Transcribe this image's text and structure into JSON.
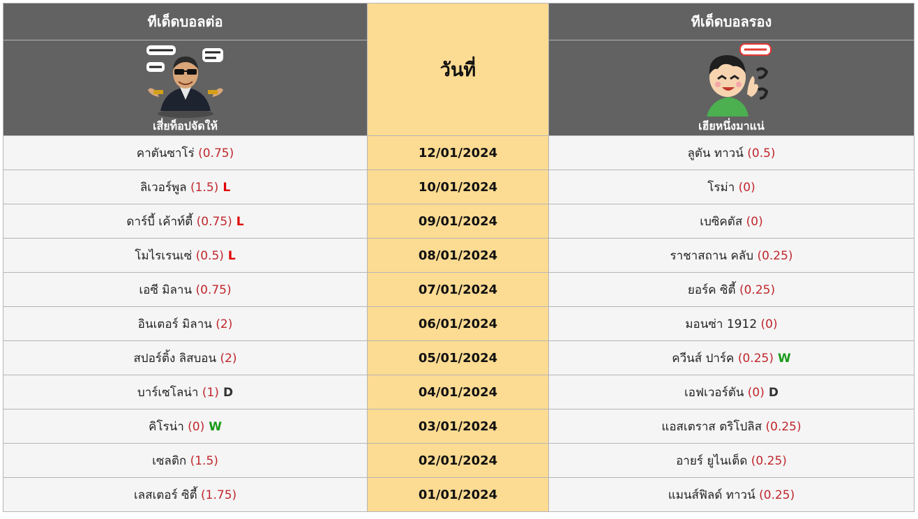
{
  "header": {
    "left_title": "ทีเด็ดบอลต่อ",
    "date_title": "วันที่",
    "right_title": "ทีเด็ดบอลรอง",
    "left_tipster": "เสี่ยท็อปจัดให้",
    "right_tipster": "เฮียหนึ่งมาแน่",
    "left_sticker_icon": "tipster-caricature-sunglasses",
    "right_sticker_icon": "tipster-cartoon-green-shirt"
  },
  "colors": {
    "header_bg": "#626262",
    "date_bg": "#fcdb92",
    "odds": "#c0272d",
    "loss": "#e00000",
    "win": "#1a9a1a",
    "draw": "#333333"
  },
  "rows": [
    {
      "date": "12/01/2024",
      "left_team": "คาตันซาโร่",
      "left_odds": "(0.75)",
      "left_result": "",
      "right_team": "ลูตัน ทาวน์",
      "right_odds": "(0.5)",
      "right_result": ""
    },
    {
      "date": "10/01/2024",
      "left_team": "ลิเวอร์พูล",
      "left_odds": "(1.5)",
      "left_result": "L",
      "right_team": "โรม่า",
      "right_odds": "(0)",
      "right_result": ""
    },
    {
      "date": "09/01/2024",
      "left_team": "ดาร์บี้ เค้าท์ตี้",
      "left_odds": "(0.75)",
      "left_result": "L",
      "right_team": "เบซิคตัส",
      "right_odds": "(0)",
      "right_result": ""
    },
    {
      "date": "08/01/2024",
      "left_team": "โมไรเรนเซ่",
      "left_odds": "(0.5)",
      "left_result": "L",
      "right_team": "ราชาสถาน คลับ",
      "right_odds": "(0.25)",
      "right_result": ""
    },
    {
      "date": "07/01/2024",
      "left_team": "เอซี มิลาน",
      "left_odds": "(0.75)",
      "left_result": "",
      "right_team": "ยอร์ค ซิตี้",
      "right_odds": "(0.25)",
      "right_result": ""
    },
    {
      "date": "06/01/2024",
      "left_team": "อินเตอร์ มิลาน",
      "left_odds": "(2)",
      "left_result": "",
      "right_team": "มอนซ่า 1912",
      "right_odds": "(0)",
      "right_result": ""
    },
    {
      "date": "05/01/2024",
      "left_team": "สปอร์ติ้ง ลิสบอน",
      "left_odds": "(2)",
      "left_result": "",
      "right_team": "ควีนส์ ปาร์ค",
      "right_odds": "(0.25)",
      "right_result": "W"
    },
    {
      "date": "04/01/2024",
      "left_team": "บาร์เซโลน่า",
      "left_odds": "(1)",
      "left_result": "D",
      "right_team": "เอฟเวอร์ตัน",
      "right_odds": "(0)",
      "right_result": "D"
    },
    {
      "date": "03/01/2024",
      "left_team": "คิโรน่า",
      "left_odds": "(0)",
      "left_result": "W",
      "right_team": "แอสเตราส ตริโปลิส",
      "right_odds": "(0.25)",
      "right_result": ""
    },
    {
      "date": "02/01/2024",
      "left_team": "เซลติก",
      "left_odds": "(1.5)",
      "left_result": "",
      "right_team": "อายร์ ยูไนเต็ด",
      "right_odds": "(0.25)",
      "right_result": ""
    },
    {
      "date": "01/01/2024",
      "left_team": "เลสเตอร์ ซิตี้",
      "left_odds": "(1.75)",
      "left_result": "",
      "right_team": "แมนส์ฟิลด์ ทาวน์",
      "right_odds": "(0.25)",
      "right_result": ""
    }
  ]
}
